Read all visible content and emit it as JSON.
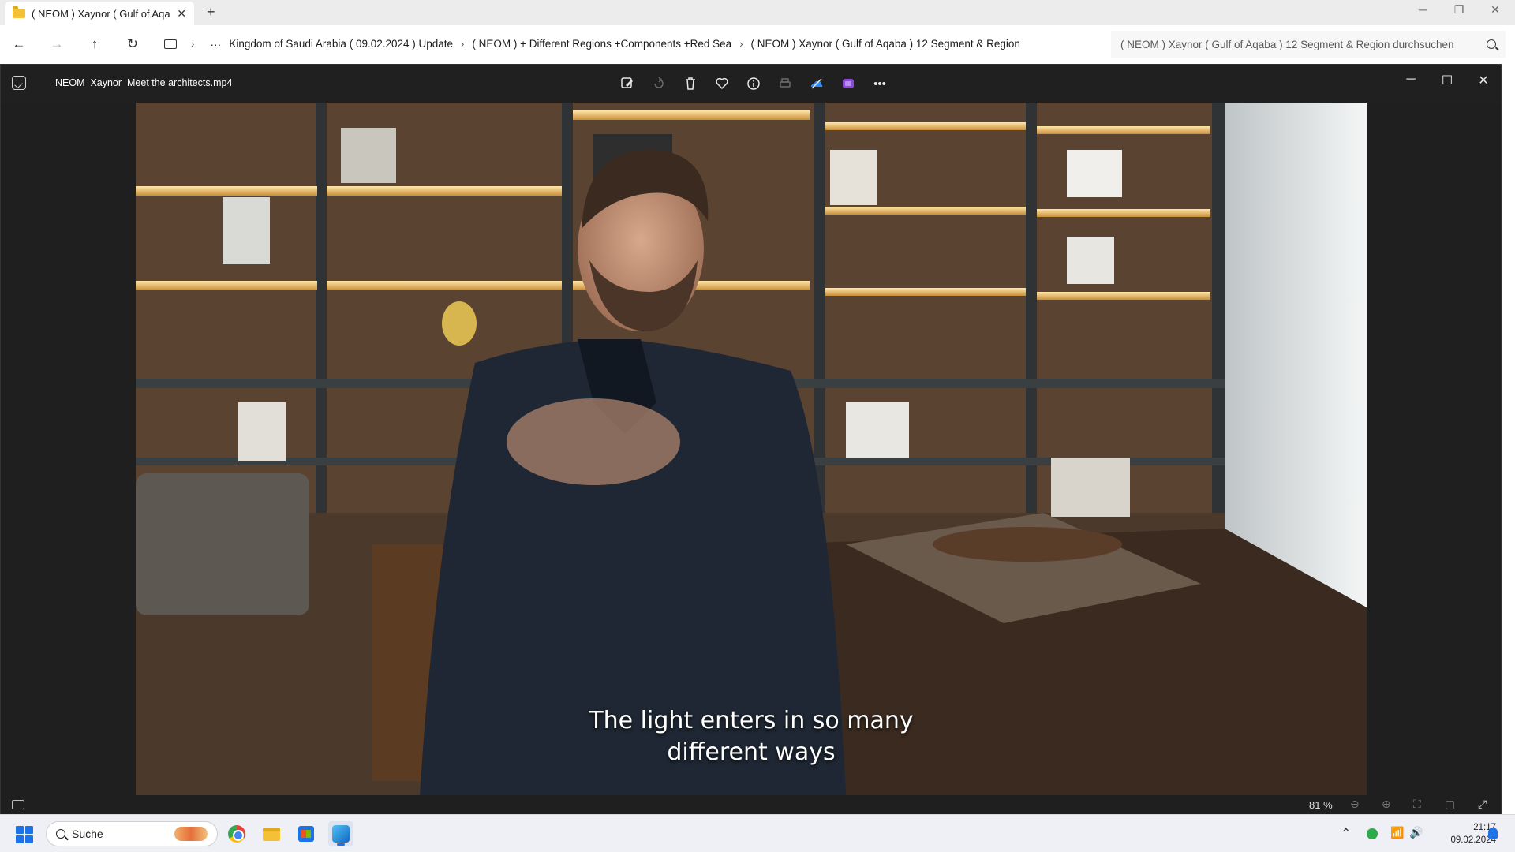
{
  "explorer": {
    "tab_title": "( NEOM ) Xaynor ( Gulf of Aqa",
    "tab_close": "✕",
    "new_tab": "+",
    "breadcrumbs": [
      "Kingdom of Saudi Arabia ( 09.02.2024 ) Update",
      "( NEOM ) + Different Regions +Components +Red Sea",
      "( NEOM ) Xaynor ( Gulf of Aqaba ) 12 Segment & Region"
    ],
    "search_placeholder": "( NEOM ) Xaynor ( Gulf of Aqaba ) 12 Segment & Region durchsuchen"
  },
  "viewer": {
    "file_name": "NEOM  Xaynor  Meet the architects.mp4",
    "subtitle_line1": "The light enters in so many",
    "subtitle_line2": "different ways",
    "zoom": "81 %"
  },
  "taskbar": {
    "search_label": "Suche",
    "time": "21:17",
    "date": "09.02.2024"
  },
  "colors": {
    "accent": "#1a73e8",
    "viewer_bg": "#1f1f1f",
    "shelf_light": "#ffd98a"
  },
  "icons": {
    "toolbar": [
      "edit-icon",
      "rotate-icon",
      "delete-icon",
      "favorite-icon",
      "info-icon",
      "print-icon",
      "onedrive-icon",
      "clipchamp-icon",
      "more-icon"
    ]
  }
}
